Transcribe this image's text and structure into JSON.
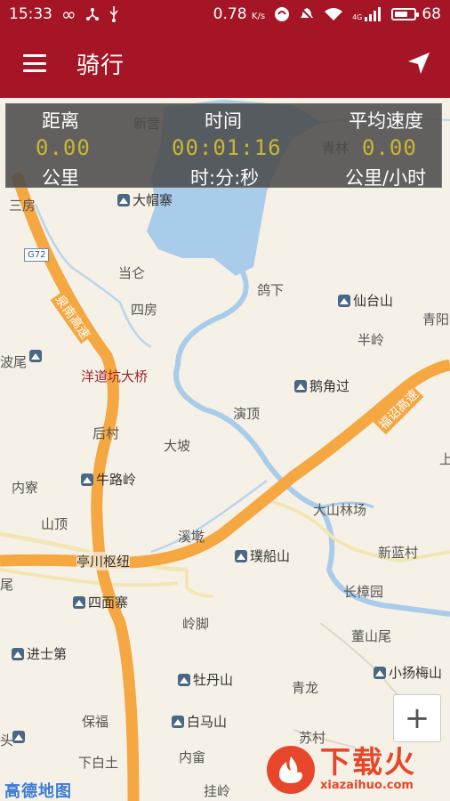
{
  "status_bar": {
    "time": "15:33",
    "speed": "0.78",
    "speed_unit": "K/s",
    "network": "4G",
    "battery": "68",
    "battery_level": 0.68
  },
  "app_bar": {
    "title": "骑行"
  },
  "stats": {
    "distance_label": "距离",
    "distance_value": "0.00",
    "distance_unit": "公里",
    "time_label": "时间",
    "time_value": "00:01:16",
    "time_unit": "时:分:秒",
    "avg_speed_label": "平均速度",
    "avg_speed_value": "0.00",
    "avg_speed_unit": "公里/小时"
  },
  "map": {
    "places": [
      "新营",
      "青林",
      "三房",
      "当仑",
      "四房",
      "鸽下",
      "青阳",
      "半岭",
      "洋道坑大桥",
      "演顶",
      "后村",
      "大坡",
      "内寮",
      "山顶",
      "溪墘",
      "新蓝村",
      "长樟园",
      "岭脚",
      "董山尾",
      "青龙",
      "保福",
      "苏村",
      "下白土",
      "内畲",
      "挂岭",
      "亭川枢纽",
      "大山林场",
      "波尾",
      "头",
      "上",
      "尾"
    ],
    "pois": [
      "大帽寨",
      "仙台山",
      "鹅角过",
      "牛路岭",
      "四面寨",
      "璞船山",
      "进士第",
      "牡丹山",
      "白马山",
      "小扬梅山"
    ],
    "roads": [
      "泉南高速",
      "福诏高速"
    ],
    "road_badge": "G72",
    "logo": "高德地图",
    "zoom_in": "+"
  },
  "watermark": {
    "cn": "下载火",
    "en": "xiazaihuo.com"
  },
  "colors": {
    "primary": "#a51525",
    "road": "#f5a742",
    "water": "#a8ccea",
    "stat_value": "#c9b733"
  }
}
